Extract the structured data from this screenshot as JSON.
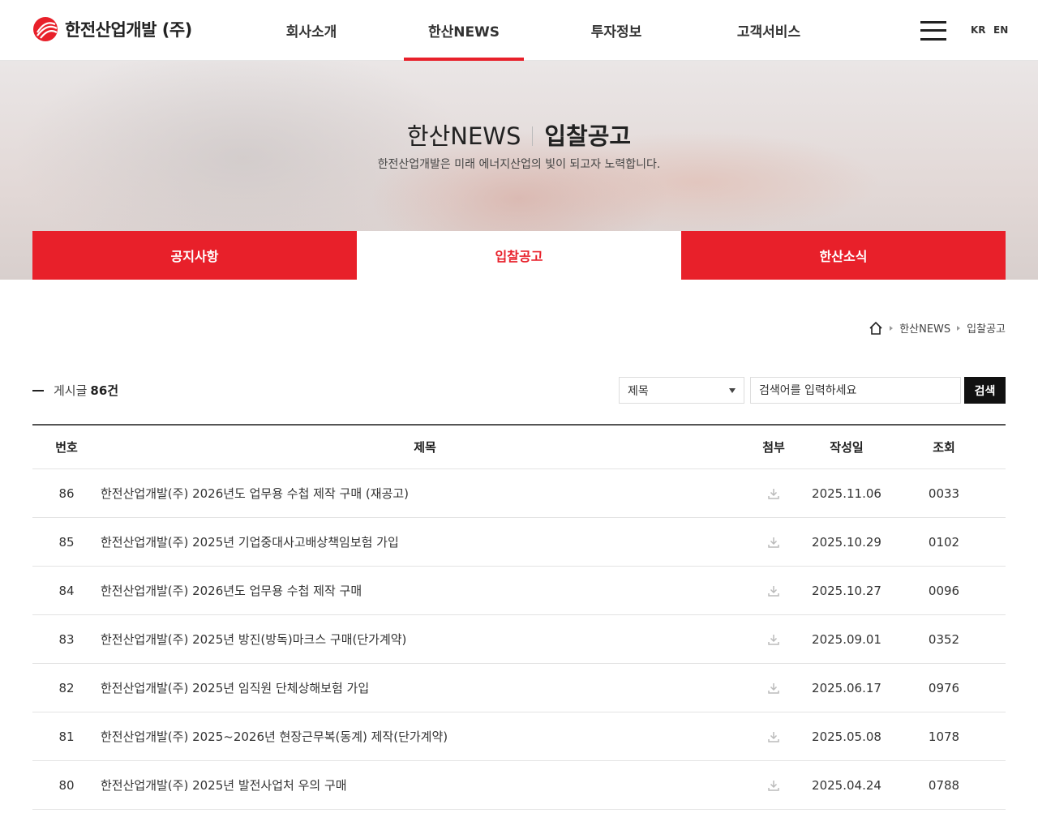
{
  "header": {
    "logo_text": "한전산업개발 (주)",
    "nav": [
      {
        "label": "회사소개",
        "active": false
      },
      {
        "label": "한산NEWS",
        "active": true
      },
      {
        "label": "투자정보",
        "active": false
      },
      {
        "label": "고객서비스",
        "active": false
      }
    ],
    "menu_icon": "hamburger-menu-icon",
    "lang": [
      "KR",
      "EN"
    ]
  },
  "visual": {
    "section": "한산NEWS",
    "page": "입찰공고",
    "subtitle": "한전산업개발은 미래 에너지산업의 빛이 되고자 노력합니다.",
    "tabs": [
      {
        "label": "공지사항",
        "active": false
      },
      {
        "label": "입찰공고",
        "active": true
      },
      {
        "label": "한산소식",
        "active": false
      }
    ]
  },
  "breadcrumb": {
    "home_icon": "home-icon",
    "items": [
      "한산NEWS",
      "입찰공고"
    ]
  },
  "board": {
    "count_label": "게시글",
    "count_value": "86건",
    "search": {
      "select_value": "제목",
      "placeholder": "검색어를 입력하세요",
      "button": "검색"
    },
    "columns": [
      "번호",
      "제목",
      "첨부",
      "작성일",
      "조회"
    ],
    "rows": [
      {
        "no": "86",
        "title": "한전산업개발(주) 2026년도 업무용 수첩 제작 구매 (재공고)",
        "date": "2025.11.06",
        "views": "0033"
      },
      {
        "no": "85",
        "title": "한전산업개발(주) 2025년 기업중대사고배상책임보험 가입",
        "date": "2025.10.29",
        "views": "0102"
      },
      {
        "no": "84",
        "title": "한전산업개발(주) 2026년도 업무용 수첩 제작 구매",
        "date": "2025.10.27",
        "views": "0096"
      },
      {
        "no": "83",
        "title": "한전산업개발(주) 2025년 방진(방독)마크스 구매(단가계약)",
        "date": "2025.09.01",
        "views": "0352"
      },
      {
        "no": "82",
        "title": "한전산업개발(주) 2025년 임직원 단체상해보험 가입",
        "date": "2025.06.17",
        "views": "0976"
      },
      {
        "no": "81",
        "title": "한전산업개발(주) 2025~2026년 현장근무복(동계) 제작(단가계약)",
        "date": "2025.05.08",
        "views": "1078"
      },
      {
        "no": "80",
        "title": "한전산업개발(주) 2025년 발전사업처 우의 구매",
        "date": "2025.04.24",
        "views": "0788"
      }
    ],
    "attachment_icon": "download-icon"
  },
  "colors": {
    "accent": "#e8202a",
    "dark": "#111111"
  }
}
